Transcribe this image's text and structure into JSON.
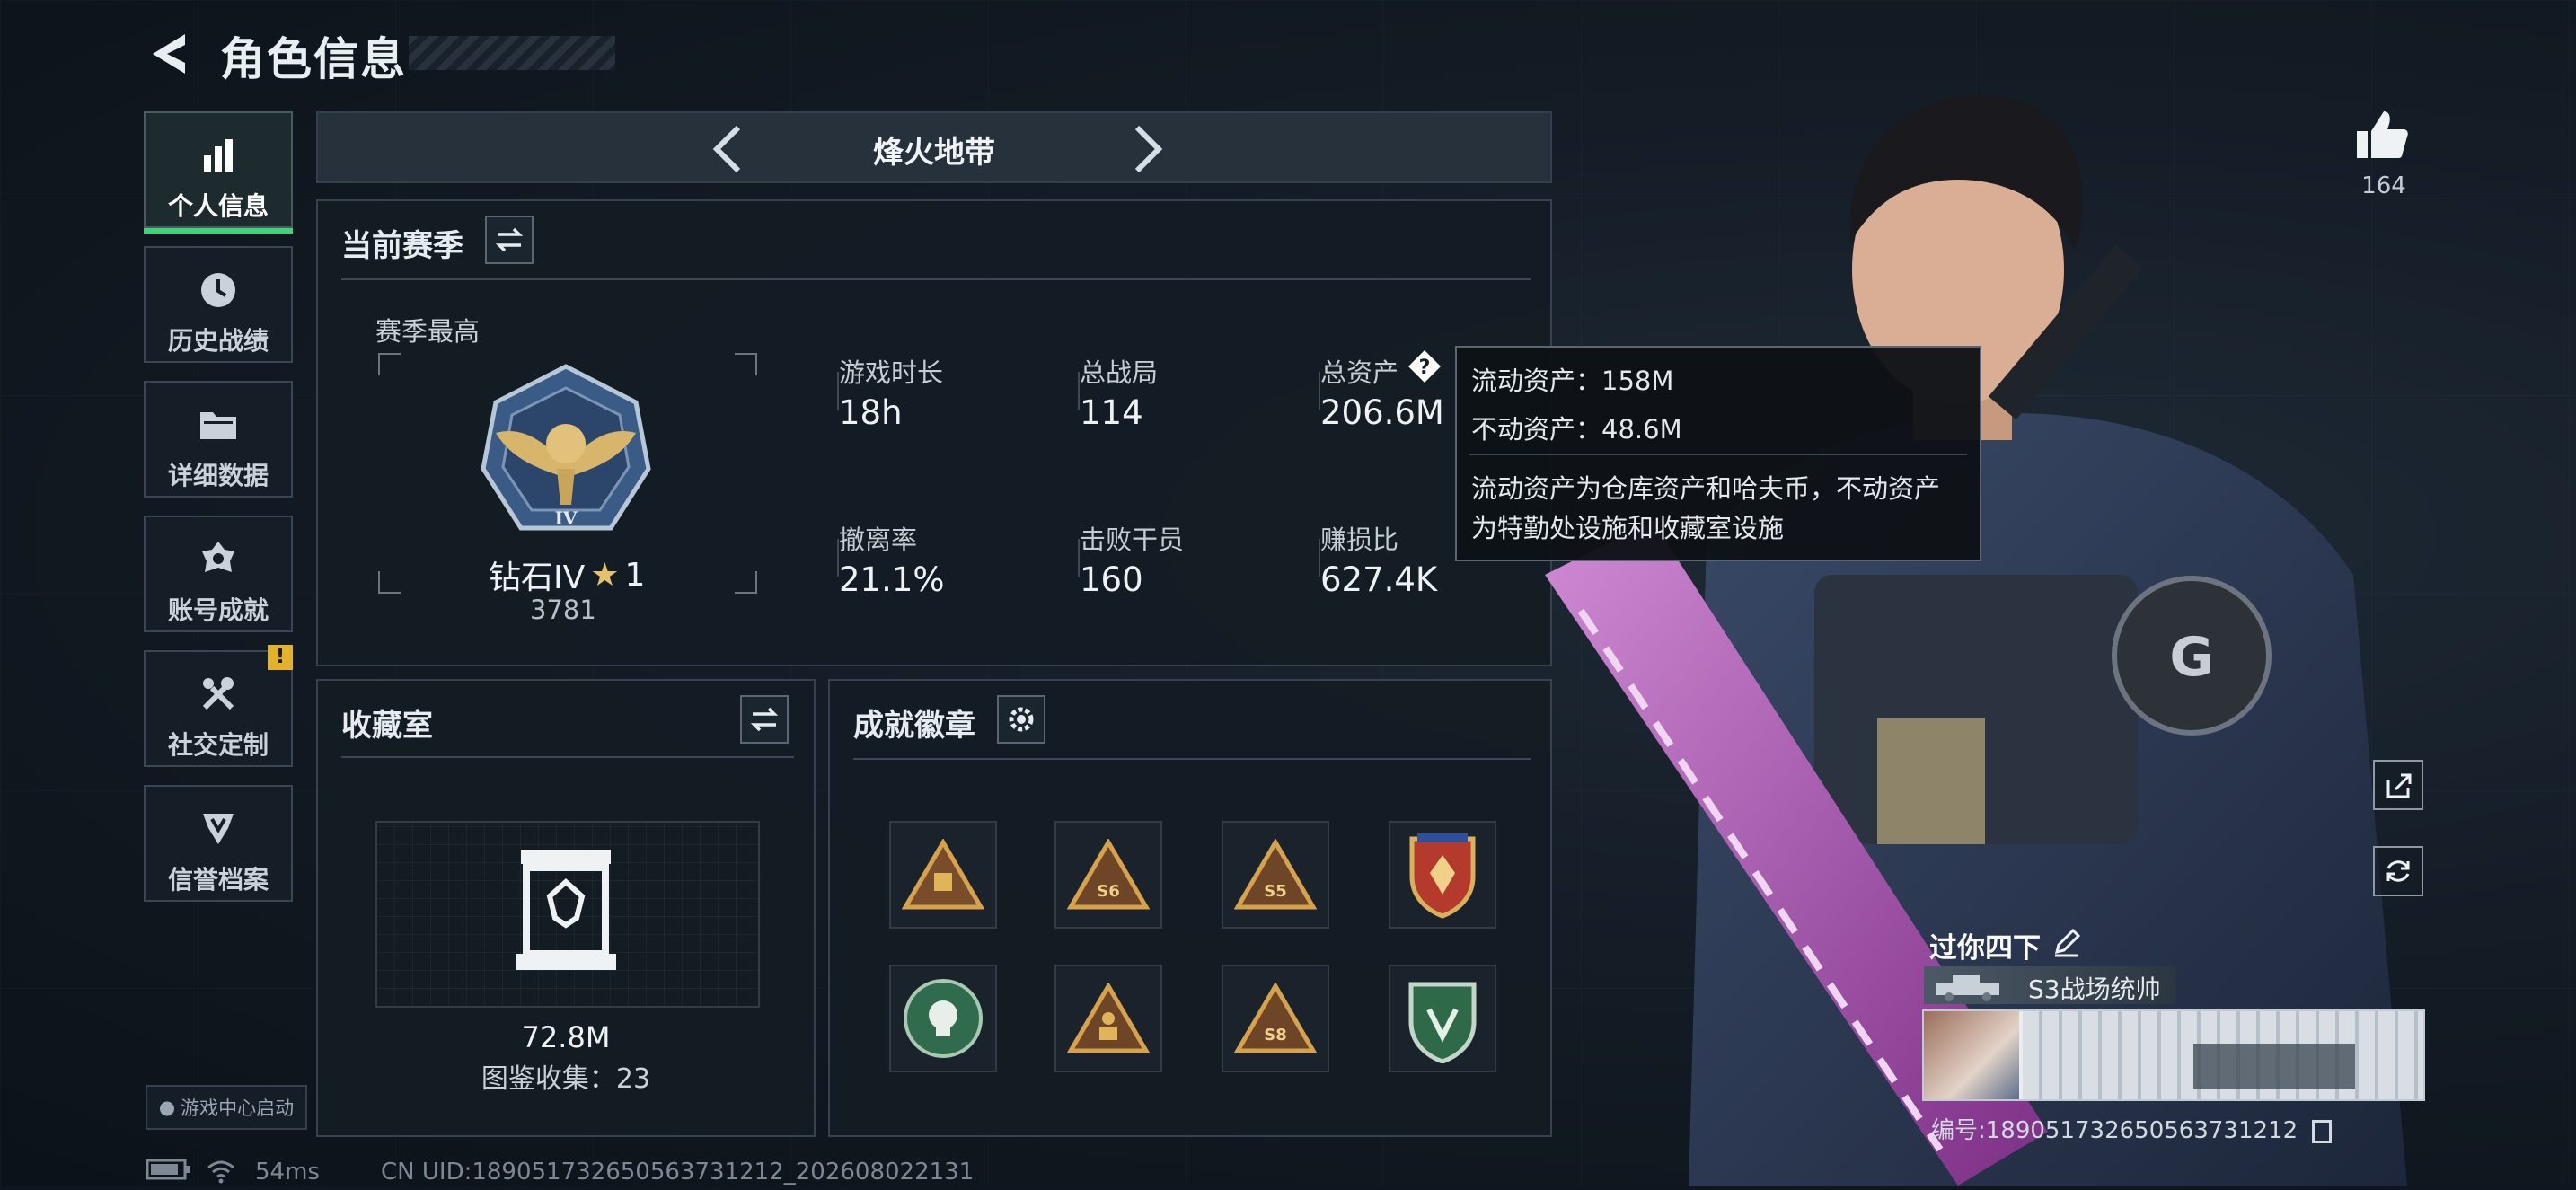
{
  "header": {
    "title": "角色信息"
  },
  "sidebar": {
    "items": [
      {
        "label": "个人信息",
        "icon": "bar-chart-icon",
        "active": true
      },
      {
        "label": "历史战绩",
        "icon": "history-clock-icon"
      },
      {
        "label": "详细数据",
        "icon": "folder-icon"
      },
      {
        "label": "账号成就",
        "icon": "medal-icon"
      },
      {
        "label": "社交定制",
        "icon": "tools-icon",
        "badge": "!"
      },
      {
        "label": "信誉档案",
        "icon": "shield-icon"
      }
    ],
    "game_center": "游戏中心启动"
  },
  "mode": {
    "name": "烽火地带"
  },
  "season": {
    "title": "当前赛季",
    "best_label": "赛季最高",
    "rank_name": "钻石IV",
    "rank_stars": "1",
    "rank_score": "3781",
    "stats": [
      {
        "label": "游戏时长",
        "value": "18h"
      },
      {
        "label": "总战局",
        "value": "114"
      },
      {
        "label": "总资产",
        "value": "206.6M"
      },
      {
        "label": "撤离率",
        "value": "21.1%"
      },
      {
        "label": "击败干员",
        "value": "160"
      },
      {
        "label": "赚损比",
        "value": "627.4K"
      }
    ]
  },
  "tooltip": {
    "line1": "流动资产：158M",
    "line2": "不动资产：48.6M",
    "line3": "流动资产为仓库资产和哈夫币，不动资产",
    "line4": "为特勤处设施和收藏室设施"
  },
  "collection": {
    "title": "收藏室",
    "value": "72.8M",
    "count": "图鉴收集：23"
  },
  "badges": {
    "title": "成就徽章"
  },
  "likes": {
    "count": "164"
  },
  "profile": {
    "name": "过你四下",
    "title": "S3战场统帅",
    "id": "编号:18905173265056373121​2"
  },
  "status": {
    "ping": "54ms",
    "uid": "CN UID:18905173265056373121​2_202608022131"
  },
  "colors": {
    "accent": "#3ed47a",
    "warning": "#e4b22a",
    "weapon": "#b45fb8"
  }
}
